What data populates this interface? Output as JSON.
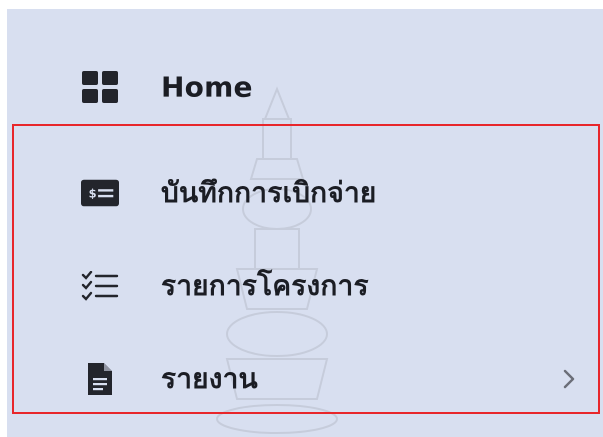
{
  "sidebar": {
    "items": [
      {
        "label": "Home",
        "icon": "grid-icon"
      },
      {
        "label": "บันทึกการเบิกจ่าย",
        "icon": "money-card-icon"
      },
      {
        "label": "รายการโครงการ",
        "icon": "checklist-icon"
      },
      {
        "label": "รายงาน",
        "icon": "document-icon",
        "has_submenu": true
      }
    ]
  },
  "colors": {
    "sidebar_bg": "#d8dff0",
    "text": "#1b1d24",
    "icon": "#23252c",
    "highlight_border": "#e8262b"
  }
}
